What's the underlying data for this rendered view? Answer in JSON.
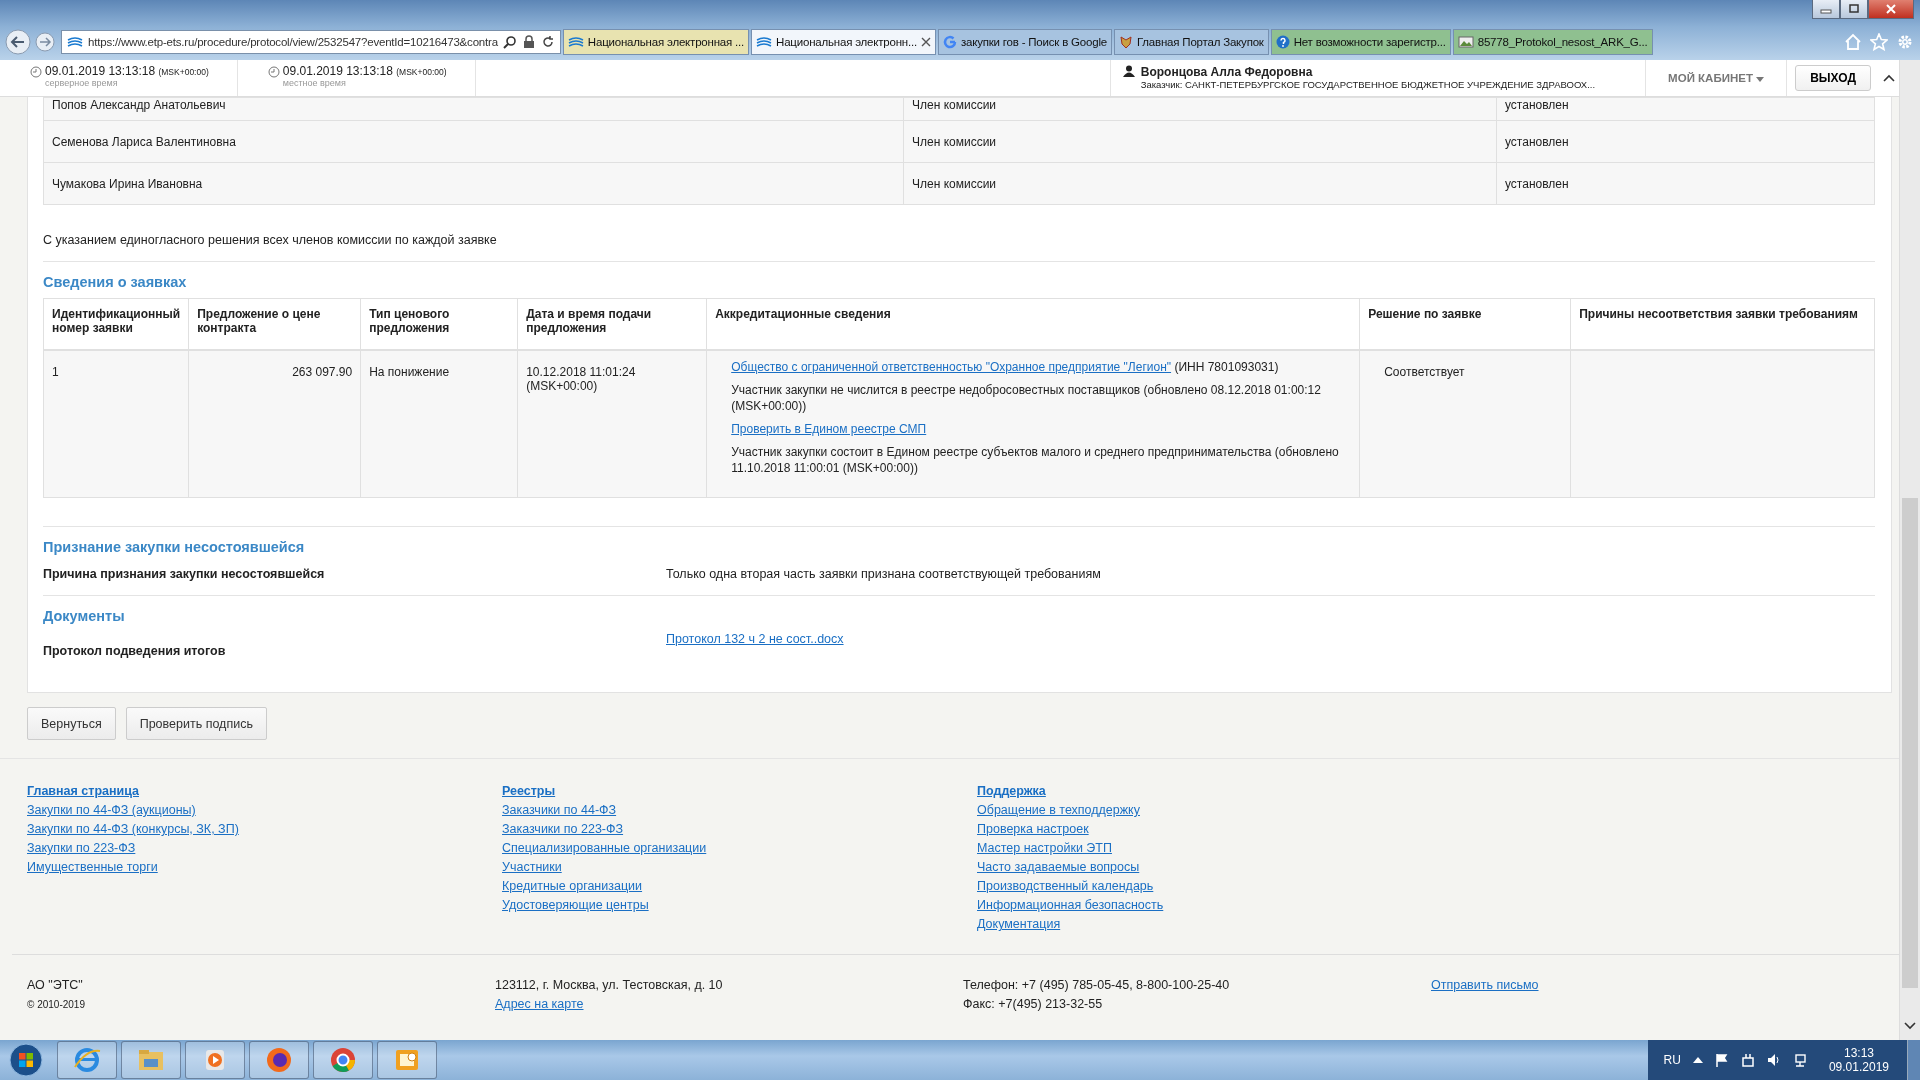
{
  "browser": {
    "address": "https://www.etp-ets.ru/procedure/protocol/view/2532547?eventId=10216473&contra",
    "tabs": [
      {
        "label": "Национальная электронная ...",
        "selected": false,
        "kind": "site",
        "closable": false
      },
      {
        "label": "Национальная электронн...",
        "selected": true,
        "kind": "site",
        "closable": true
      },
      {
        "label": "закупки гов - Поиск в Google",
        "selected": false,
        "kind": "google",
        "closable": false
      },
      {
        "label": "Главная Портал Закупок",
        "selected": false,
        "kind": "emblem",
        "closable": false
      },
      {
        "label": "Нет возможности зарегистр...",
        "selected": false,
        "kind": "help",
        "closable": false
      },
      {
        "label": "85778_Protokol_nesost_ARK_G...",
        "selected": false,
        "kind": "image",
        "closable": false
      }
    ]
  },
  "header": {
    "clocks": [
      {
        "time": "09.01.2019 13:13:18",
        "zone": "(MSK+00:00)",
        "caption": "серверное время"
      },
      {
        "time": "09.01.2019 13:13:18",
        "zone": "(MSK+00:00)",
        "caption": "местное время"
      }
    ],
    "user": {
      "name": "Воронцова Алла Федоровна",
      "org": "Заказчик: САНКТ-ПЕТЕРБУРГСКОЕ ГОСУДАРСТВЕННОЕ БЮДЖЕТНОЕ УЧРЕЖДЕНИЕ ЗДРАВООХ..."
    },
    "cabinet": "МОЙ КАБИНЕТ",
    "logout": "ВЫХОД"
  },
  "commission": {
    "rows": [
      {
        "name": "Попов Александр Анатольевич",
        "role": "Член комиссии",
        "status": "установлен"
      },
      {
        "name": "Семенова Лариса Валентиновна",
        "role": "Член комиссии",
        "status": "установлен"
      },
      {
        "name": "Чумакова Ирина Ивановна",
        "role": "Член комиссии",
        "status": "установлен"
      }
    ]
  },
  "unanimous_note": "С указанием единогласного решения всех членов комиссии по каждой заявке",
  "bids": {
    "title": "Сведения о заявках",
    "columns": [
      "Идентификационный номер заявки",
      "Предложение о цене контракта",
      "Тип ценового предложения",
      "Дата и время подачи предложения",
      "Аккредитационные сведения",
      "Решение по заявке",
      "Причины несоответствия заявки требованиям"
    ],
    "rows": [
      {
        "number": "1",
        "price": "263 097.90",
        "price_type": "На понижение",
        "submitted": "10.12.2018 11:01:24 (MSK+00:00)",
        "accreditation": [
          {
            "kind": "link_text",
            "link": "Общество с ограниченной ответственностью \"Охранное предприятие \"Легион\"",
            "text": " (ИНН 7801093031)"
          },
          {
            "kind": "text",
            "text": "Участник закупки не числится в реестре недобросовестных поставщиков (обновлено 08.12.2018 01:00:12 (MSK+00:00))"
          },
          {
            "kind": "link",
            "link": "Проверить в Едином реестре СМП"
          },
          {
            "kind": "text",
            "text": "Участник закупки состоит в Едином реестре субъектов малого и среднего предпринимательства (обновлено 11.10.2018 11:00:01 (MSK+00:00))"
          }
        ],
        "decision": "Соответствует"
      }
    ]
  },
  "failure": {
    "title": "Признание закупки несостоявшейся",
    "label": "Причина признания закупки несостоявшейся",
    "value": "Только одна вторая часть заявки признана соответствующей требованиям"
  },
  "documents": {
    "title": "Документы",
    "label": "Протокол подведения итогов",
    "link": "Протокол 132 ч 2 не сост..docx"
  },
  "buttons": [
    "Вернуться",
    "Проверить подпись"
  ],
  "footer": {
    "columns": [
      {
        "title": "Главная страница",
        "links": [
          "Закупки по 44-ФЗ (аукционы)",
          "Закупки по 44-ФЗ (конкурсы, ЗК, ЗП)",
          "Закупки по 223-ФЗ",
          "Имущественные торги"
        ]
      },
      {
        "title": "Реестры",
        "links": [
          "Заказчики по 44-ФЗ",
          "Заказчики по 223-ФЗ",
          "Специализированные организации",
          "Участники",
          "Кредитные организации",
          "Удостоверяющие центры"
        ]
      },
      {
        "title": "Поддержка",
        "links": [
          "Обращение в техподдержку",
          "Проверка настроек",
          "Мастер настройки ЭТП",
          "Часто задаваемые вопросы",
          "Производственный календарь",
          "Информационная безопасность",
          "Документация"
        ]
      }
    ],
    "company": "АО \"ЭТС\"",
    "copyright": "© 2010-2019",
    "address": "123112, г. Москва, ул. Тестовская, д. 10",
    "map_link": "Адрес на карте",
    "phone": "Телефон: +7 (495) 785-05-45, 8-800-100-25-40",
    "fax": "Факс: +7(495) 213-32-55",
    "mail_link": "Отправить письмо"
  },
  "taskbar": {
    "language": "RU",
    "time": "13:13",
    "date": "09.01.2019"
  }
}
